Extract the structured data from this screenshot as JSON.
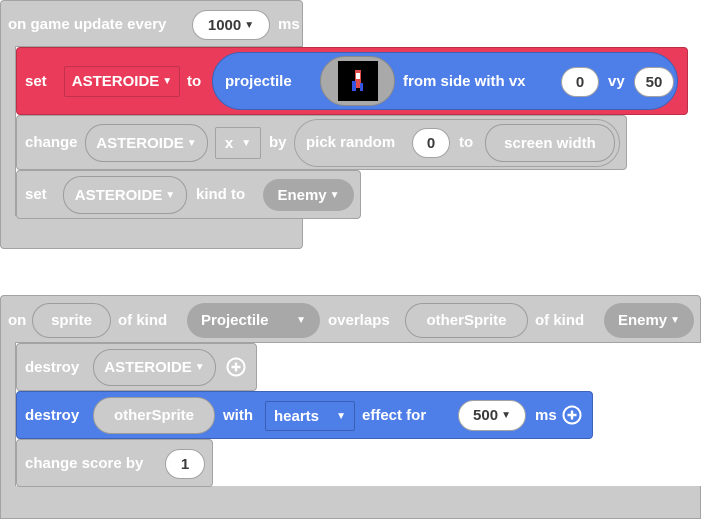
{
  "event1": {
    "label": "on game update every",
    "interval": "1000",
    "unit": "ms"
  },
  "set_projectile": {
    "set": "set",
    "variable": "ASTEROIDE",
    "to": "to",
    "projectile": "projectile",
    "from_side": "from side with vx",
    "vx": "0",
    "vy_label": "vy",
    "vy": "50"
  },
  "change_x": {
    "change": "change",
    "variable": "ASTEROIDE",
    "property": "x",
    "by": "by",
    "pick_random": "pick random",
    "min": "0",
    "to": "to",
    "max": "screen width"
  },
  "set_kind": {
    "set": "set",
    "variable": "ASTEROIDE",
    "kind_to": "kind to",
    "kind": "Enemy"
  },
  "event2": {
    "on": "on",
    "sprite": "sprite",
    "of_kind1": "of kind",
    "kind1": "Projectile",
    "overlaps": "overlaps",
    "other_sprite": "otherSprite",
    "of_kind2": "of kind",
    "kind2": "Enemy"
  },
  "destroy1": {
    "destroy": "destroy",
    "variable": "ASTEROIDE"
  },
  "destroy2": {
    "destroy": "destroy",
    "target": "otherSprite",
    "with": "with",
    "effect": "hearts",
    "effect_for": "effect for",
    "duration": "500",
    "unit": "ms"
  },
  "change_score": {
    "label": "change score by",
    "value": "1"
  },
  "colors": {
    "event_gray": "#cbcbcb",
    "sprite_red": "#ea3c5a",
    "projectile_blue": "#4e7ee8"
  }
}
